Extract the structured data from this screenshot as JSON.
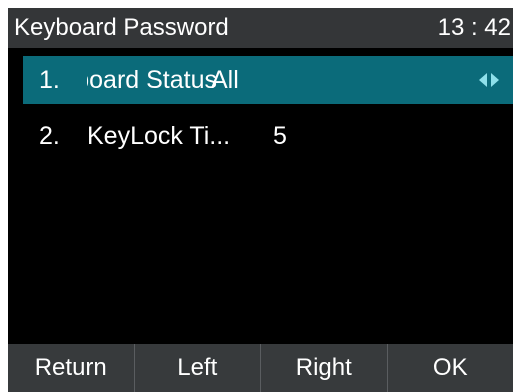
{
  "header": {
    "title": "Keyboard Password",
    "time": "13 : 42"
  },
  "menu": {
    "items": [
      {
        "index": "1.",
        "label": "Keyboard Status",
        "value": "All",
        "selected": true
      },
      {
        "index": "2.",
        "label": "KeyLock Ti...",
        "value": "5",
        "selected": false
      }
    ]
  },
  "softkeys": {
    "return": "Return",
    "left": "Left",
    "right": "Right",
    "ok": "OK"
  },
  "colors": {
    "selected_row": "#0b6b7a",
    "title_bar": "#343638",
    "softkey_bar": "#373a3c",
    "arrow_accent": "#8fe0ea"
  },
  "icons": {
    "left_arrow": "arrow-left-icon",
    "right_arrow": "arrow-right-icon"
  }
}
